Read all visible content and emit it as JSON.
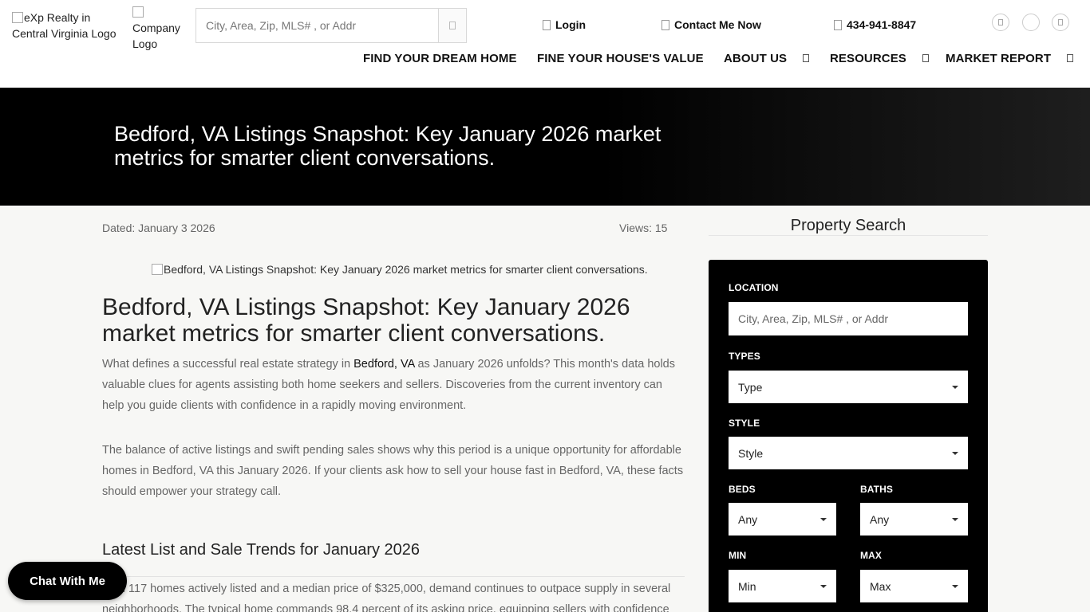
{
  "header": {
    "logo_alt": "eXp Realty in Central Virginia Logo",
    "company_logo_alt": "Company Logo",
    "search_placeholder": "City, Area, Zip, MLS# , or Addr",
    "login_label": "Login",
    "contact_label": "Contact Me Now",
    "phone_label": "434-941-8847",
    "nav": [
      {
        "label": "FIND YOUR DREAM HOME"
      },
      {
        "label": "FINE YOUR HOUSE'S VALUE"
      },
      {
        "label": "ABOUT US"
      },
      {
        "label": "RESOURCES"
      },
      {
        "label": "MARKET REPORT"
      }
    ]
  },
  "banner": {
    "title": "Bedford, VA Listings Snapshot: Key January 2026 market metrics for smarter client conversations."
  },
  "article": {
    "dated": "Dated: January 3 2026",
    "views": "Views: 15",
    "image_alt": "Bedford, VA Listings Snapshot: Key January 2026 market metrics for smarter client conversations.",
    "title": "Bedford, VA Listings Snapshot: Key January 2026 market metrics for smarter client conversations.",
    "p1_a": "What defines a successful real estate strategy in ",
    "p1_link": "Bedford, VA",
    "p1_b": " as January 2026 unfolds? This month's data holds valuable clues for agents assisting both home seekers and sellers. Discoveries from the current inventory can help you guide clients with confidence in a rapidly moving environment.",
    "p2": "The balance of active listings and swift pending sales shows why this period is a unique opportunity for affordable homes in Bedford, VA this January 2026. If your clients ask how to sell your house fast in Bedford, VA, these facts should empower your strategy call.",
    "section_heading": "Latest List and Sale Trends for January 2026",
    "p3": "With 117 homes actively listed and a median price of $325,000, demand continues to outpace supply in several neighborhoods. The typical home commands 98.4 percent of its asking price, equipping sellers with confidence"
  },
  "chat": {
    "label": "Chat With Me"
  },
  "sidebar": {
    "title": "Property Search",
    "location_label": "LOCATION",
    "location_placeholder": "City, Area, Zip, MLS# , or Addr",
    "types_label": "TYPES",
    "types_value": "Type",
    "style_label": "STYLE",
    "style_value": "Style",
    "beds_label": "BEDS",
    "beds_value": "Any",
    "baths_label": "BATHS",
    "baths_value": "Any",
    "min_label": "MIN",
    "min_value": "Min",
    "max_label": "MAX",
    "max_value": "Max"
  }
}
